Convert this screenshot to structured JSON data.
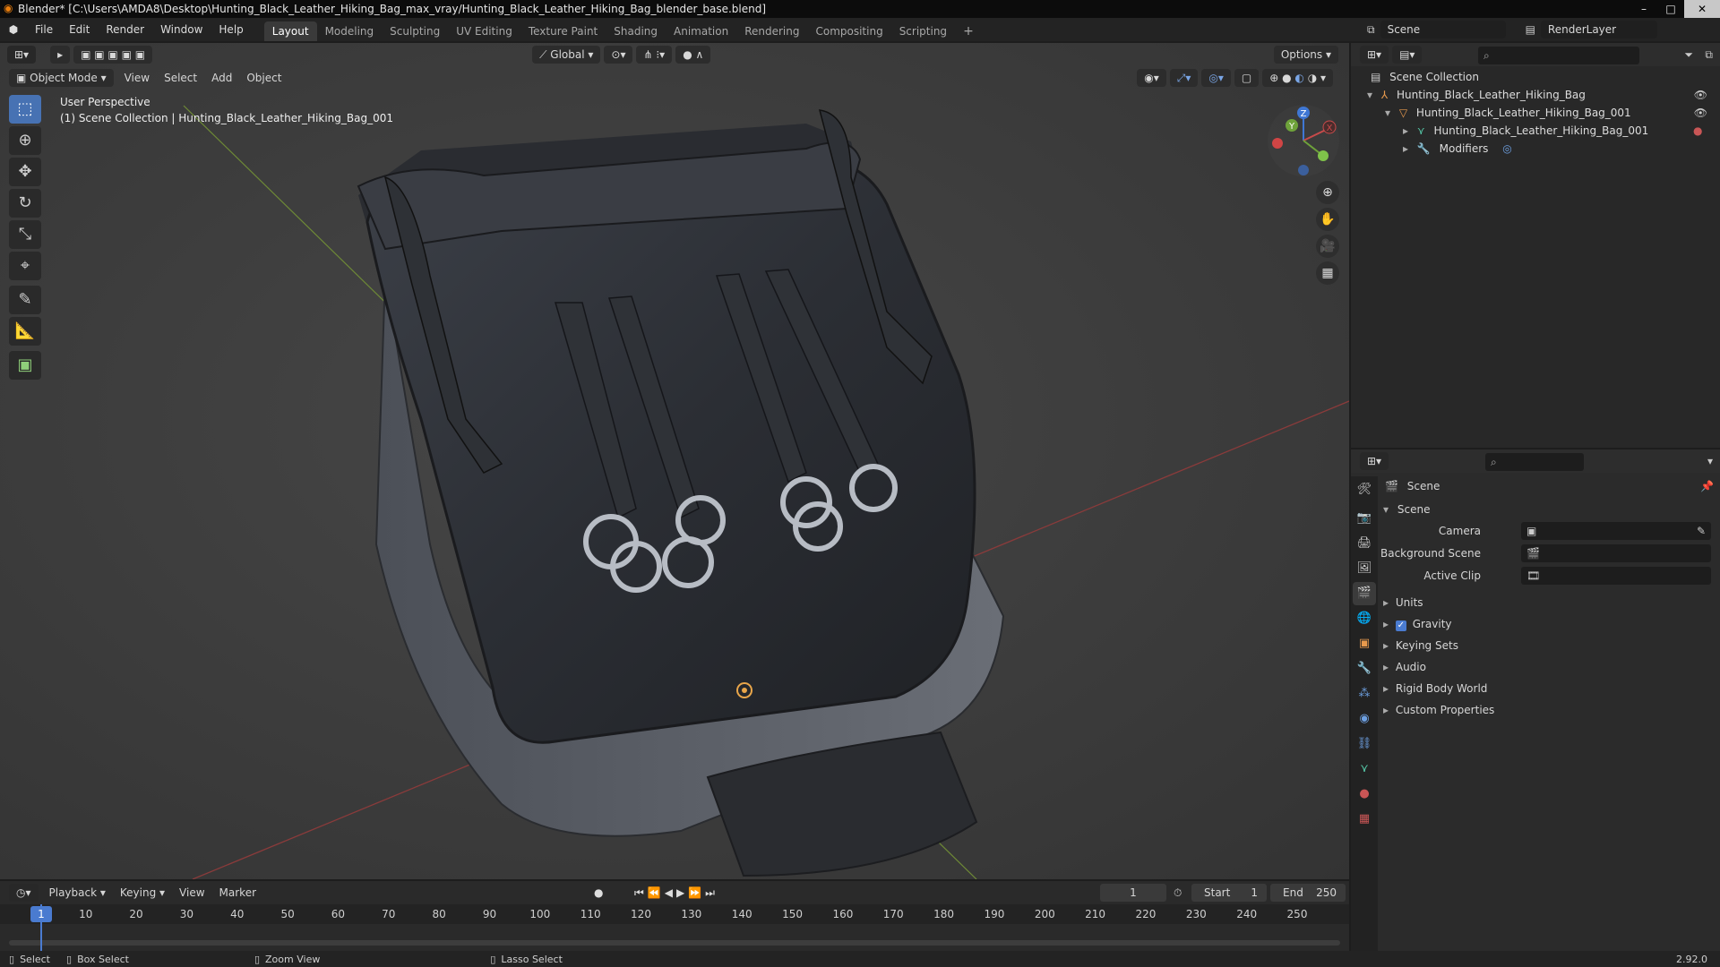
{
  "title_bar": {
    "text": "Blender* [C:\\Users\\AMDA8\\Desktop\\Hunting_Black_Leather_Hiking_Bag_max_vray/Hunting_Black_Leather_Hiking_Bag_blender_base.blend]",
    "min": "–",
    "max": "□",
    "close": "✕"
  },
  "menu": [
    "File",
    "Edit",
    "Render",
    "Window",
    "Help"
  ],
  "workspaces": [
    "Layout",
    "Modeling",
    "Sculpting",
    "UV Editing",
    "Texture Paint",
    "Shading",
    "Animation",
    "Rendering",
    "Compositing",
    "Scripting"
  ],
  "scene_selector": "Scene",
  "view_layer": "RenderLayer",
  "viewport": {
    "transform_orientation": "Global",
    "options_label": "Options",
    "mode": "Object Mode",
    "menus": [
      "View",
      "Select",
      "Add",
      "Object"
    ],
    "overlay_line1": "User Perspective",
    "overlay_line2": "(1) Scene Collection | Hunting_Black_Leather_Hiking_Bag_001",
    "gizmo": {
      "x": "X",
      "y": "Y",
      "z": "Z"
    }
  },
  "outliner": {
    "root": "Scene Collection",
    "rows": [
      "Hunting_Black_Leather_Hiking_Bag",
      "Hunting_Black_Leather_Hiking_Bag_001",
      "Hunting_Black_Leather_Hiking_Bag_001",
      "Modifiers"
    ]
  },
  "properties": {
    "header": "Scene",
    "panel": "Scene",
    "camera_label": "Camera",
    "bg_scene_label": "Background Scene",
    "active_clip_label": "Active Clip",
    "sections": [
      "Units",
      "Gravity",
      "Keying Sets",
      "Audio",
      "Rigid Body World",
      "Custom Properties"
    ]
  },
  "timeline": {
    "menus": [
      "Playback",
      "Keying",
      "View",
      "Marker"
    ],
    "current_frame": "1",
    "start_label": "Start",
    "start": "1",
    "end_label": "End",
    "end": "250",
    "ticks": [
      "1",
      "10",
      "20",
      "30",
      "40",
      "50",
      "60",
      "70",
      "80",
      "90",
      "100",
      "110",
      "120",
      "130",
      "140",
      "150",
      "160",
      "170",
      "180",
      "190",
      "200",
      "210",
      "220",
      "230",
      "240",
      "250"
    ]
  },
  "status": {
    "select": "Select",
    "box_select": "Box Select",
    "zoom_view": "Zoom View",
    "lasso_select": "Lasso Select",
    "version": "2.92.0"
  }
}
